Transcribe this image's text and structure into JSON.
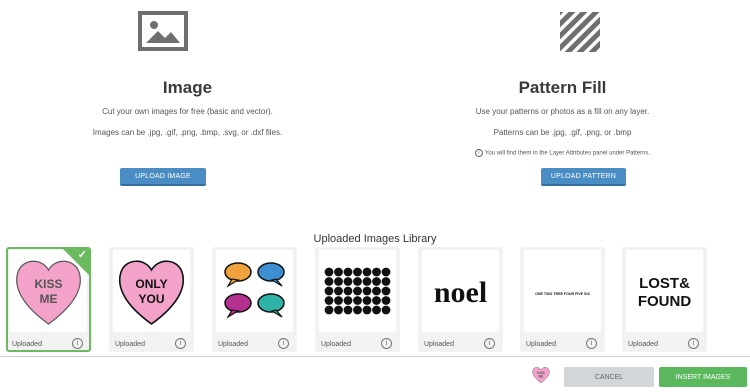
{
  "image_section": {
    "title": "Image",
    "desc1": "Cut your own images for free (basic and vector).",
    "desc2": "Images can be .jpg, .gif, .png, .bmp, .svg, or .dxf files.",
    "button": "UPLOAD IMAGE",
    "icon": "image-icon"
  },
  "pattern_section": {
    "title": "Pattern Fill",
    "desc1": "Use your patterns or photos as a fill on any layer.",
    "desc2": "Patterns can be .jpg, .gif, .png, or .bmp",
    "note": "You will find them in the Layer Attributes panel under Patterns.",
    "button": "UPLOAD PATTERN",
    "icon": "stripes-icon"
  },
  "library": {
    "title": "Uploaded Images Library",
    "items": [
      {
        "label": "Uploaded",
        "thumb_text1": "KISS",
        "thumb_text2": "ME",
        "selected": true
      },
      {
        "label": "Uploaded",
        "thumb_text1": "ONLY",
        "thumb_text2": "YOU",
        "selected": false
      },
      {
        "label": "Uploaded",
        "selected": false
      },
      {
        "label": "Uploaded",
        "selected": false
      },
      {
        "label": "Uploaded",
        "thumb_text1": "noel",
        "selected": false
      },
      {
        "label": "Uploaded",
        "thumb_text1": "ONE TWO TREE FOUR FIVE SIX",
        "selected": false
      },
      {
        "label": "Uploaded",
        "thumb_text1": "LOST&",
        "thumb_text2": "FOUND",
        "selected": false
      }
    ]
  },
  "footer": {
    "cancel": "CANCEL",
    "insert": "INSERT IMAGES",
    "mini_thumb_text1": "KISS",
    "mini_thumb_text2": "ME"
  },
  "colors": {
    "upload_button": "#4a8cc4",
    "selected_border": "#6cba5f",
    "insert_button": "#5cb85c",
    "heart_pink": "#f3a3c9"
  }
}
